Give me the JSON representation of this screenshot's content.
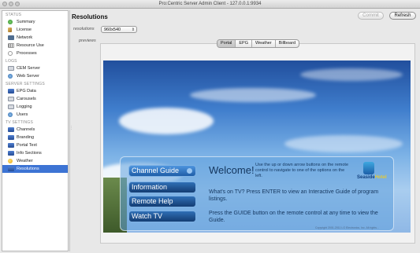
{
  "window": {
    "title": "Pro:Centric Server Admin Client - 127.0.0.1:9934"
  },
  "sidebar": {
    "sections": [
      {
        "title": "STATUS",
        "items": [
          {
            "label": "Summary",
            "icon": "summary-icon"
          },
          {
            "label": "License",
            "icon": "license-icon"
          },
          {
            "label": "Network",
            "icon": "network-icon"
          },
          {
            "label": "Resource Use",
            "icon": "resource-icon"
          },
          {
            "label": "Processes",
            "icon": "processes-icon"
          }
        ]
      },
      {
        "title": "LOGS",
        "items": [
          {
            "label": "CEM Server",
            "icon": "log-icon"
          },
          {
            "label": "Web Server",
            "icon": "globe-icon"
          }
        ]
      },
      {
        "title": "SERVER SETTINGS",
        "items": [
          {
            "label": "EPG Data",
            "icon": "epg-icon"
          },
          {
            "label": "Carousels",
            "icon": "carousel-icon"
          },
          {
            "label": "Logging",
            "icon": "logging-icon"
          },
          {
            "label": "Users",
            "icon": "users-icon"
          }
        ]
      },
      {
        "title": "TV SETTINGS",
        "items": [
          {
            "label": "Channels",
            "icon": "channels-icon"
          },
          {
            "label": "Branding",
            "icon": "branding-icon"
          },
          {
            "label": "Portal Text",
            "icon": "portal-text-icon"
          },
          {
            "label": "Info Sections",
            "icon": "info-sections-icon"
          },
          {
            "label": "Weather",
            "icon": "weather-icon"
          },
          {
            "label": "Resolutions",
            "icon": "resolutions-icon",
            "selected": true
          }
        ]
      }
    ]
  },
  "main": {
    "title": "Resolutions",
    "commit_label": "Commit",
    "refresh_label": "Refresh",
    "resolutions_label": "resolutions",
    "resolution_value": "960x540",
    "previews_label": "previews",
    "tabs": [
      "Portal",
      "EPG",
      "Weather",
      "Billboard"
    ],
    "active_tab": "Portal"
  },
  "preview": {
    "menu": [
      "Channel Guide",
      "Information",
      "Remote Help",
      "Watch TV"
    ],
    "welcome": "Welcome!",
    "help_text": "Use the up or down arrow buttons on the remote control to navigate to one of the options on the left.",
    "paragraph1": "What's on TV? Press ENTER to view an Interactive Guide of program listings.",
    "paragraph2": "Press the GUIDE button on the remote control at any time to view the Guide.",
    "logo_text_1": "Seaside",
    "logo_text_2": "Hotel",
    "copyright": "Copyright 2001-2011 LG Electronics, Inc. All rights..."
  }
}
